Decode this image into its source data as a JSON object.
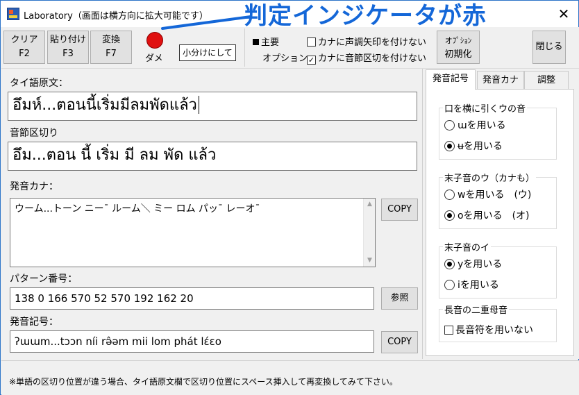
{
  "window": {
    "title": "Laboratory（画面は横方向に拡大可能です）",
    "close_glyph": "✕"
  },
  "annotation": {
    "text": "判定インジケータが赤",
    "color": "#1467d8"
  },
  "toolbar": {
    "clear": {
      "label": "クリア",
      "key": "F2"
    },
    "paste": {
      "label": "貼り付け",
      "key": "F3"
    },
    "convert": {
      "label": "変換",
      "key": "F7"
    },
    "indicator": {
      "color": "#e01010",
      "status": "ダメ"
    },
    "subdivide_label": "小分けにして",
    "option_main": "主要",
    "option_label": "オプション",
    "cb_no_arrow": "カナに声調矢印を付けない",
    "cb_no_syllable": "カナに音節区切を付けない",
    "cb_no_syllable_checked": true,
    "init_option": "オﾌﾟｼｮﾝ",
    "init_label": "初期化",
    "close_label": "閉じる"
  },
  "main": {
    "thai_label": "タイ語原文：",
    "thai_value": "อึมห์...ตอนนี้เริ่มมีลมพัดแล้ว",
    "syllable_label": "音節区切り",
    "syllable_value": "อึม...ตอน นี้ เริ่ม มี ลม พัด แล้ว",
    "kana_label": "発音カナ：",
    "kana_value": "ウーム...トーン ニーˉ ルーム＼ ミー ロム パッˉ レーオˉ",
    "kana_copy": "COPY",
    "pattern_label": "パターン番号：",
    "pattern_value": "138 0 166 570 52 570 192 162 20",
    "pattern_ref": "参照",
    "phon_label": "発音記号：",
    "phon_value": "ʔɯɯm...tɔɔn níi rə̂əm mii lom phát lɛ́ɛo",
    "phon_copy": "COPY"
  },
  "right": {
    "tabs": [
      "発音記号",
      "発音カナ",
      "調整"
    ],
    "group1": {
      "title": "口を横に引くウの音",
      "opt1": "ɯを用いる",
      "opt2": "ʉを用いる",
      "selected": 2
    },
    "group2": {
      "title": "末子音のウ（カナも）",
      "opt1": "wを用いる　(ウ)",
      "opt2": "oを用いる　(オ)",
      "selected": 2
    },
    "group3": {
      "title": "末子音のイ",
      "opt1": "yを用いる",
      "opt2": "iを用いる",
      "selected": 1
    },
    "group4": {
      "title": "長音の二重母音",
      "cb": "長音符を用いない"
    }
  },
  "footer": {
    "note": "※単語の区切り位置が違う場合、タイ語原文欄で区切り位置にスペース挿入して再変換してみて下さい。"
  }
}
